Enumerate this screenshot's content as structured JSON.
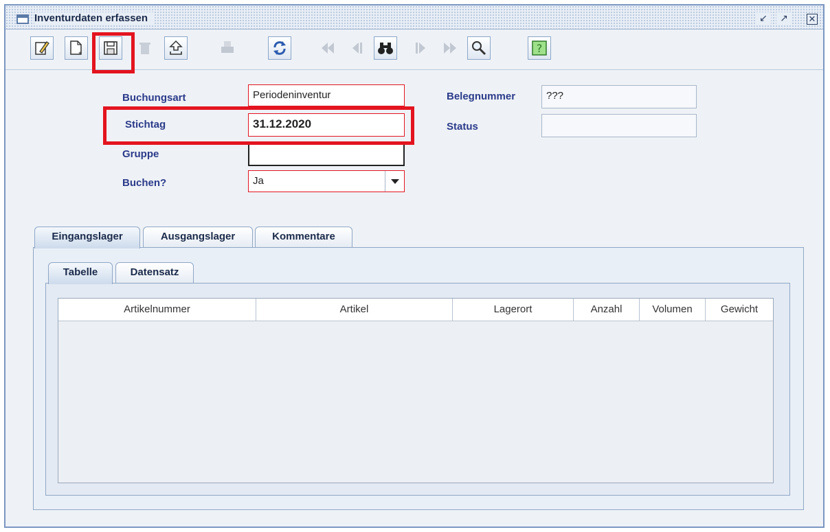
{
  "window": {
    "title": "Inventurdaten erfassen"
  },
  "form": {
    "buchungsart": {
      "label": "Buchungsart",
      "value": "Periodeninventur"
    },
    "stichtag": {
      "label": "Stichtag",
      "value": "31.12.2020"
    },
    "gruppe": {
      "label": "Gruppe",
      "value": ""
    },
    "buchen": {
      "label": "Buchen?",
      "value": "Ja"
    },
    "belegnummer": {
      "label": "Belegnummer",
      "value": "???"
    },
    "status": {
      "label": "Status",
      "value": ""
    }
  },
  "tabs": [
    {
      "label": "Eingangslager"
    },
    {
      "label": "Ausgangslager"
    },
    {
      "label": "Kommentare"
    }
  ],
  "subtabs": [
    {
      "label": "Tabelle"
    },
    {
      "label": "Datensatz"
    }
  ],
  "table": {
    "columns": [
      "Artikelnummer",
      "Artikel",
      "Lagerort",
      "Anzahl",
      "Volumen",
      "Gewicht"
    ],
    "rows": []
  },
  "colors": {
    "highlight": "#e3141f",
    "label": "#2b3a8a",
    "frame": "#7a96c2"
  }
}
